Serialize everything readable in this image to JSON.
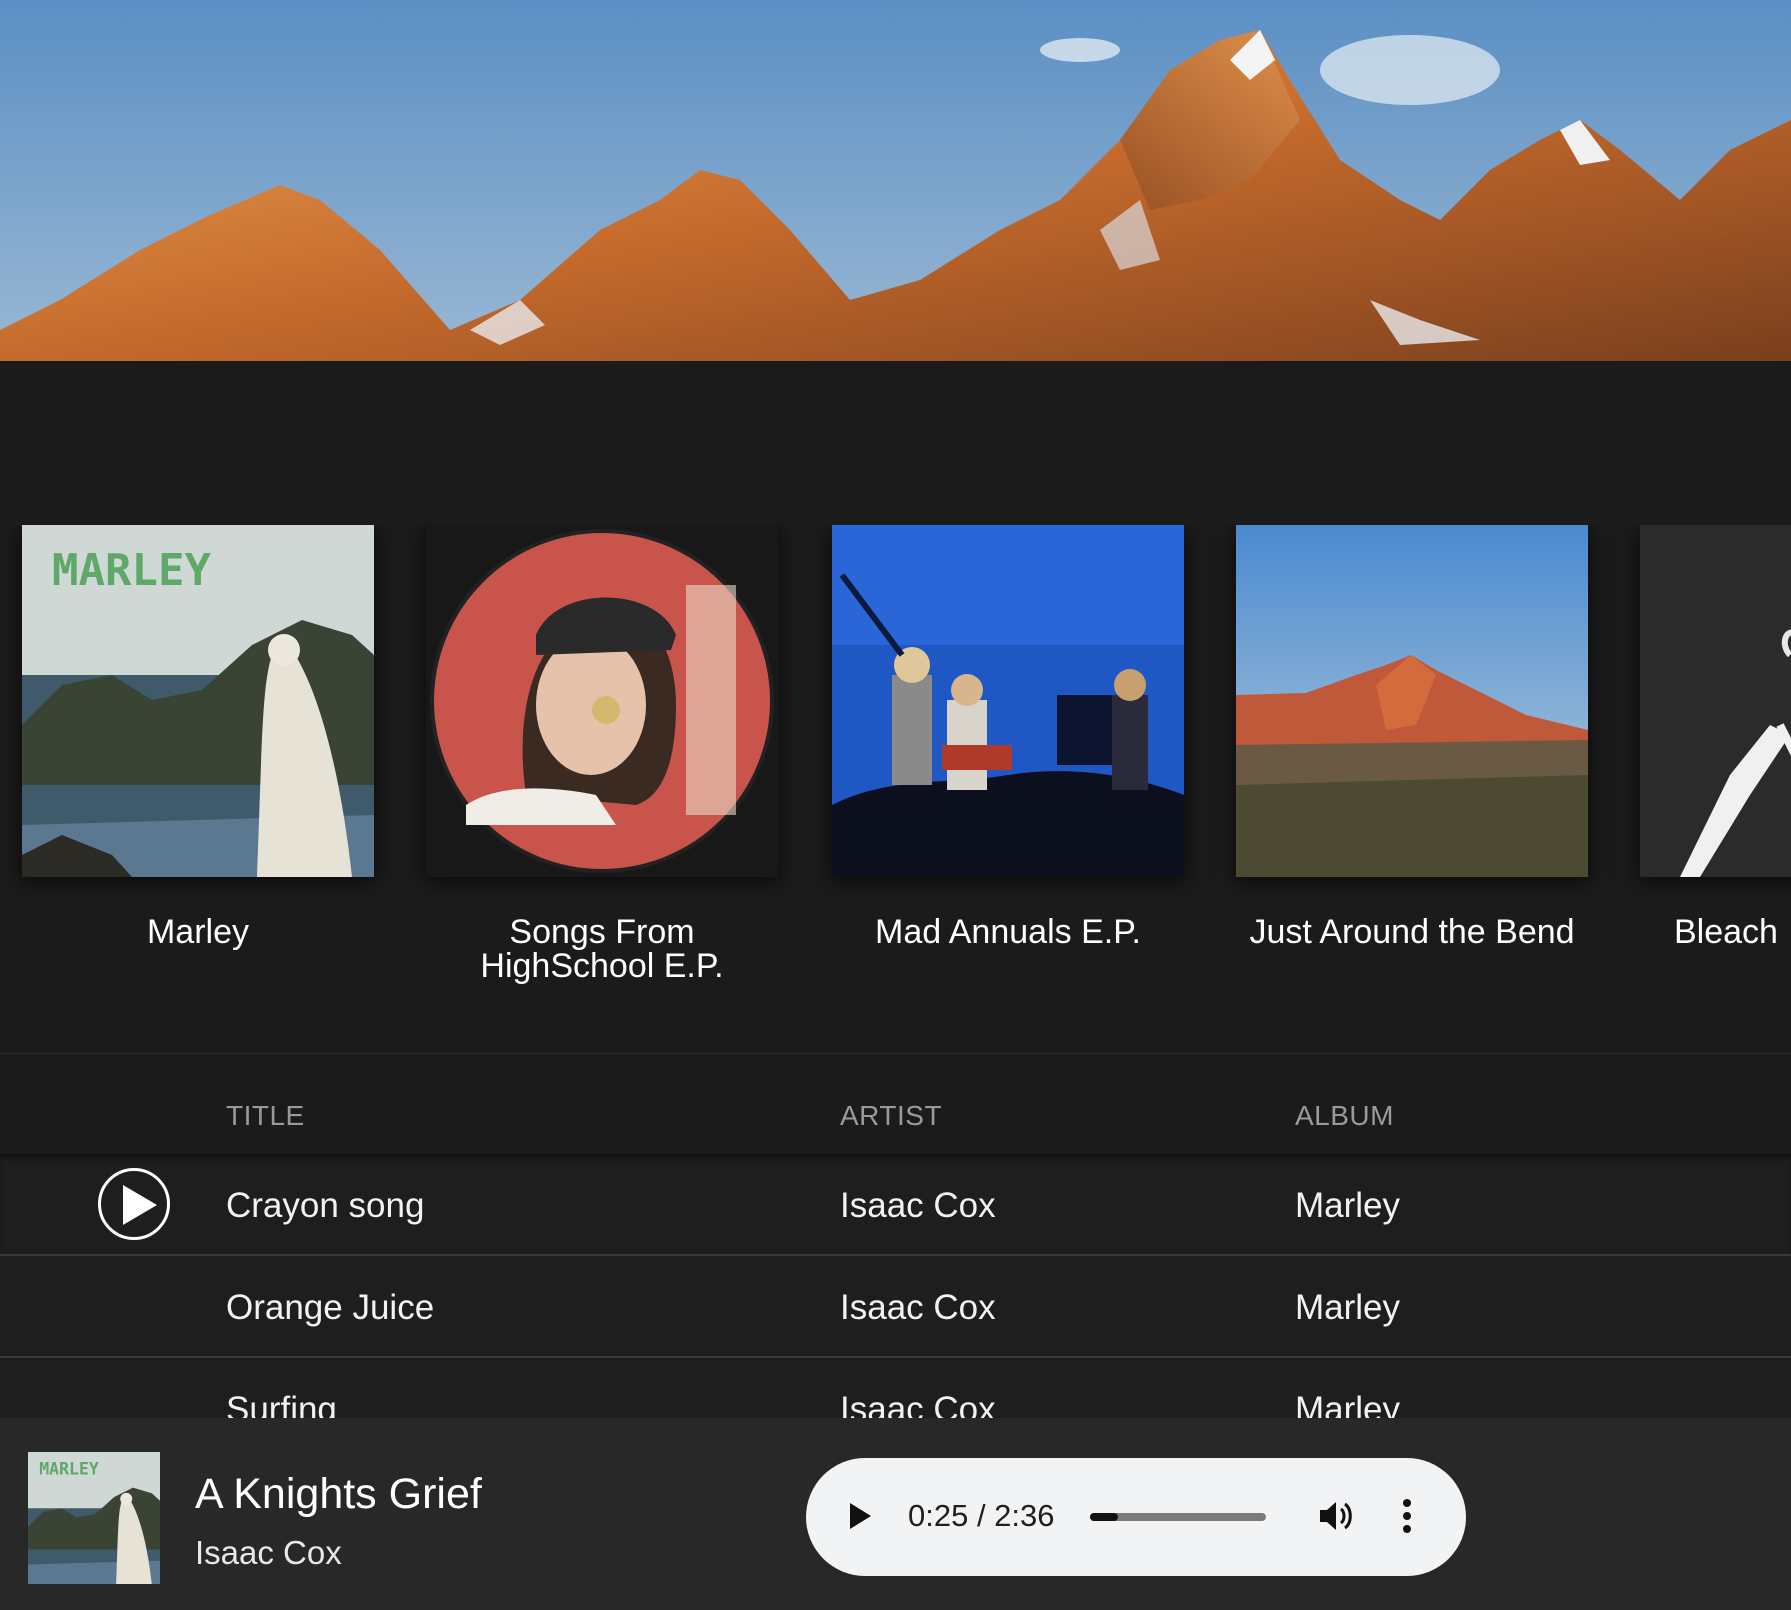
{
  "albums": [
    {
      "name": "Marley"
    },
    {
      "name": "Songs From\nHighSchool E.P."
    },
    {
      "name": "Mad Annuals E.P."
    },
    {
      "name": "Just Around the Bend"
    },
    {
      "name": "Bleach"
    }
  ],
  "cover_texts": {
    "marley": "MARLEY"
  },
  "table": {
    "headers": {
      "title": "TITLE",
      "artist": "ARTIST",
      "album": "ALBUM"
    },
    "rows": [
      {
        "title": "Crayon song",
        "artist": "Isaac Cox",
        "album": "Marley"
      },
      {
        "title": "Orange Juice",
        "artist": "Isaac Cox",
        "album": "Marley"
      },
      {
        "title": "Surfing",
        "artist": "Isaac Cox",
        "album": "Marley"
      }
    ]
  },
  "player": {
    "title": "A Knights Grief",
    "artist": "Isaac Cox",
    "time": "0:25 / 2:36",
    "progress_fraction": 0.16,
    "icons": [
      "play-icon",
      "volume-icon",
      "more-options-icon"
    ]
  },
  "colors": {
    "background": "#1b1b1b",
    "player_bar": "#282828",
    "audio_control": "#f1f3f4"
  }
}
